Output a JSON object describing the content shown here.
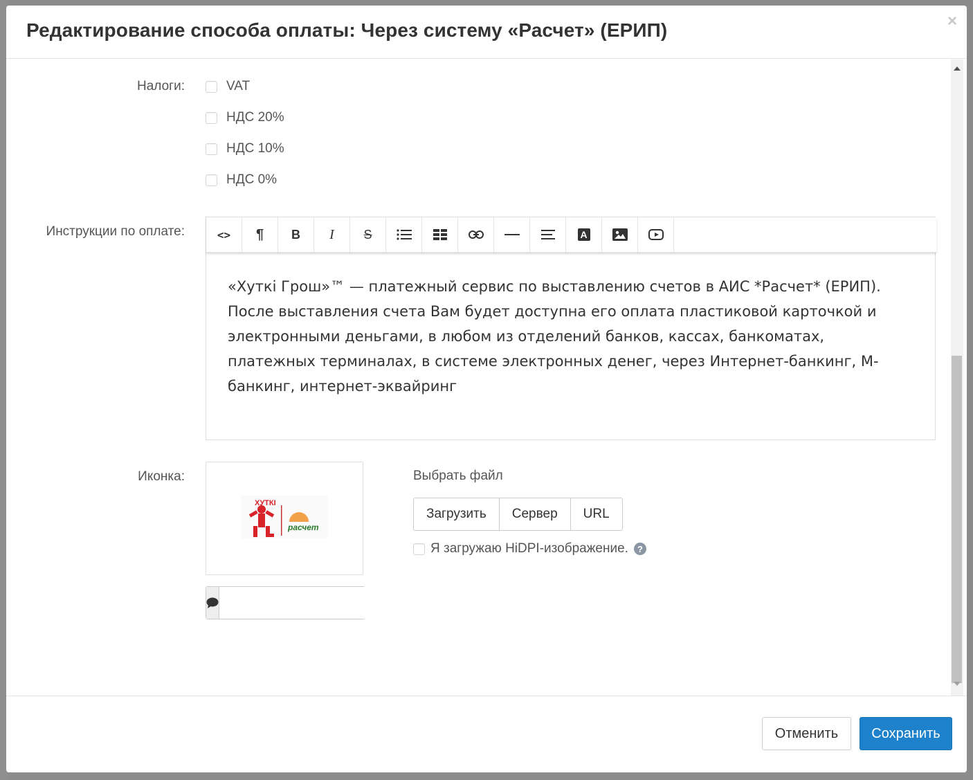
{
  "modal": {
    "title": "Редактирование способа оплаты: Через систему «Расчет» (ЕРИП)",
    "close_glyph": "×"
  },
  "taxes": {
    "label": "Налоги:",
    "options": [
      {
        "label": "VAT",
        "checked": false
      },
      {
        "label": "НДС 20%",
        "checked": false
      },
      {
        "label": "НДС 10%",
        "checked": false
      },
      {
        "label": "НДС 0%",
        "checked": false
      }
    ]
  },
  "instructions": {
    "label": "Инструкции по оплате:",
    "toolbar": [
      {
        "name": "code-view",
        "glyph": "<>"
      },
      {
        "name": "paragraph-format",
        "glyph": "¶"
      },
      {
        "name": "bold",
        "glyph": "B"
      },
      {
        "name": "italic",
        "glyph": "I"
      },
      {
        "name": "strikethrough",
        "glyph": "S"
      },
      {
        "name": "unordered-list",
        "glyph": ""
      },
      {
        "name": "table",
        "glyph": ""
      },
      {
        "name": "link",
        "glyph": ""
      },
      {
        "name": "horizontal-rule",
        "glyph": ""
      },
      {
        "name": "align",
        "glyph": ""
      },
      {
        "name": "font-color",
        "glyph": "A"
      },
      {
        "name": "image",
        "glyph": ""
      },
      {
        "name": "video",
        "glyph": ""
      }
    ],
    "content": "«Хуткі Грош»™ — платежный сервис по выставлению счетов в АИС *Расчет* (ЕРИП). После выставления счета Вам будет доступна его оплата пластиковой карточкой и электронными деньгами, в любом из отделений банков, кассах, банкоматах, платежных терминалах, в системе электронных денег, через Интернет-банкинг, М-банкинг, интернет-эквайринг"
  },
  "icon_field": {
    "label": "Иконка:",
    "logo_text_left": "ХУТКІ",
    "logo_text_right": "расчет",
    "caption_value": "",
    "choose_file_label": "Выбрать файл",
    "upload_buttons": [
      "Загрузить",
      "Сервер",
      "URL"
    ],
    "hidpi_label": "Я загружаю HiDPI-изображение.",
    "help_glyph": "?"
  },
  "footer": {
    "cancel_label": "Отменить",
    "save_label": "Сохранить"
  },
  "colors": {
    "primary": "#1d82cb",
    "backdrop": "#8c8c8c"
  }
}
